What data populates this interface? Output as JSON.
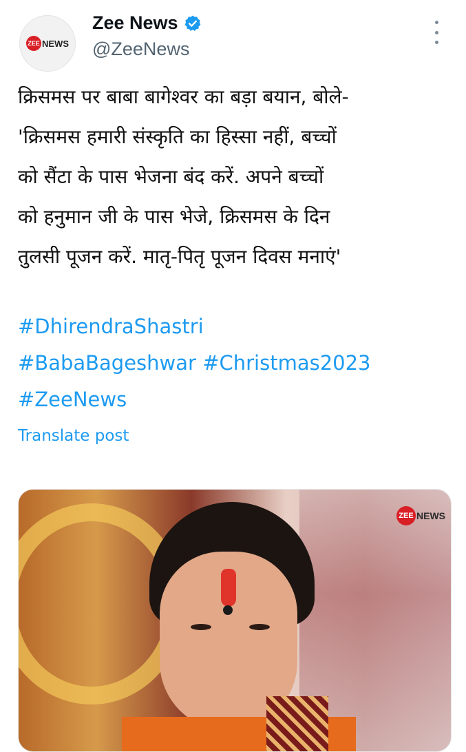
{
  "account": {
    "display_name": "Zee News",
    "handle": "@ZeeNews",
    "verified": true,
    "avatar_logo": {
      "badge": "ZEE",
      "text": "NEWS"
    }
  },
  "tweet": {
    "lines": [
      "क्रिसमस पर बाबा बागेश्वर का बड़ा बयान, बोले-",
      "'क्रिसमस हमारी संस्कृति का हिस्सा नहीं, बच्चों",
      "को सैंटा के पास भेजना बंद करें. अपने बच्चों",
      "को हनुमान जी के पास भेजे, क्रिसमस के दिन",
      "तुलसी पूजन करें. मातृ-पितृ पूजन दिवस मनाएं'"
    ],
    "hashtags": [
      "#DhirendraShastri",
      "#BabaBageshwar",
      "#Christmas2023",
      "#ZeeNews"
    ],
    "translate_label": "Translate post"
  },
  "media": {
    "logo": {
      "badge": "ZEE",
      "text": "NEWS"
    }
  },
  "icons": {
    "verified": "verified-badge-icon",
    "more": "more-options-icon"
  },
  "colors": {
    "link": "#1d9bf0",
    "verified": "#1d9bf0",
    "brand_red": "#d91f26",
    "handle_gray": "#536471"
  }
}
